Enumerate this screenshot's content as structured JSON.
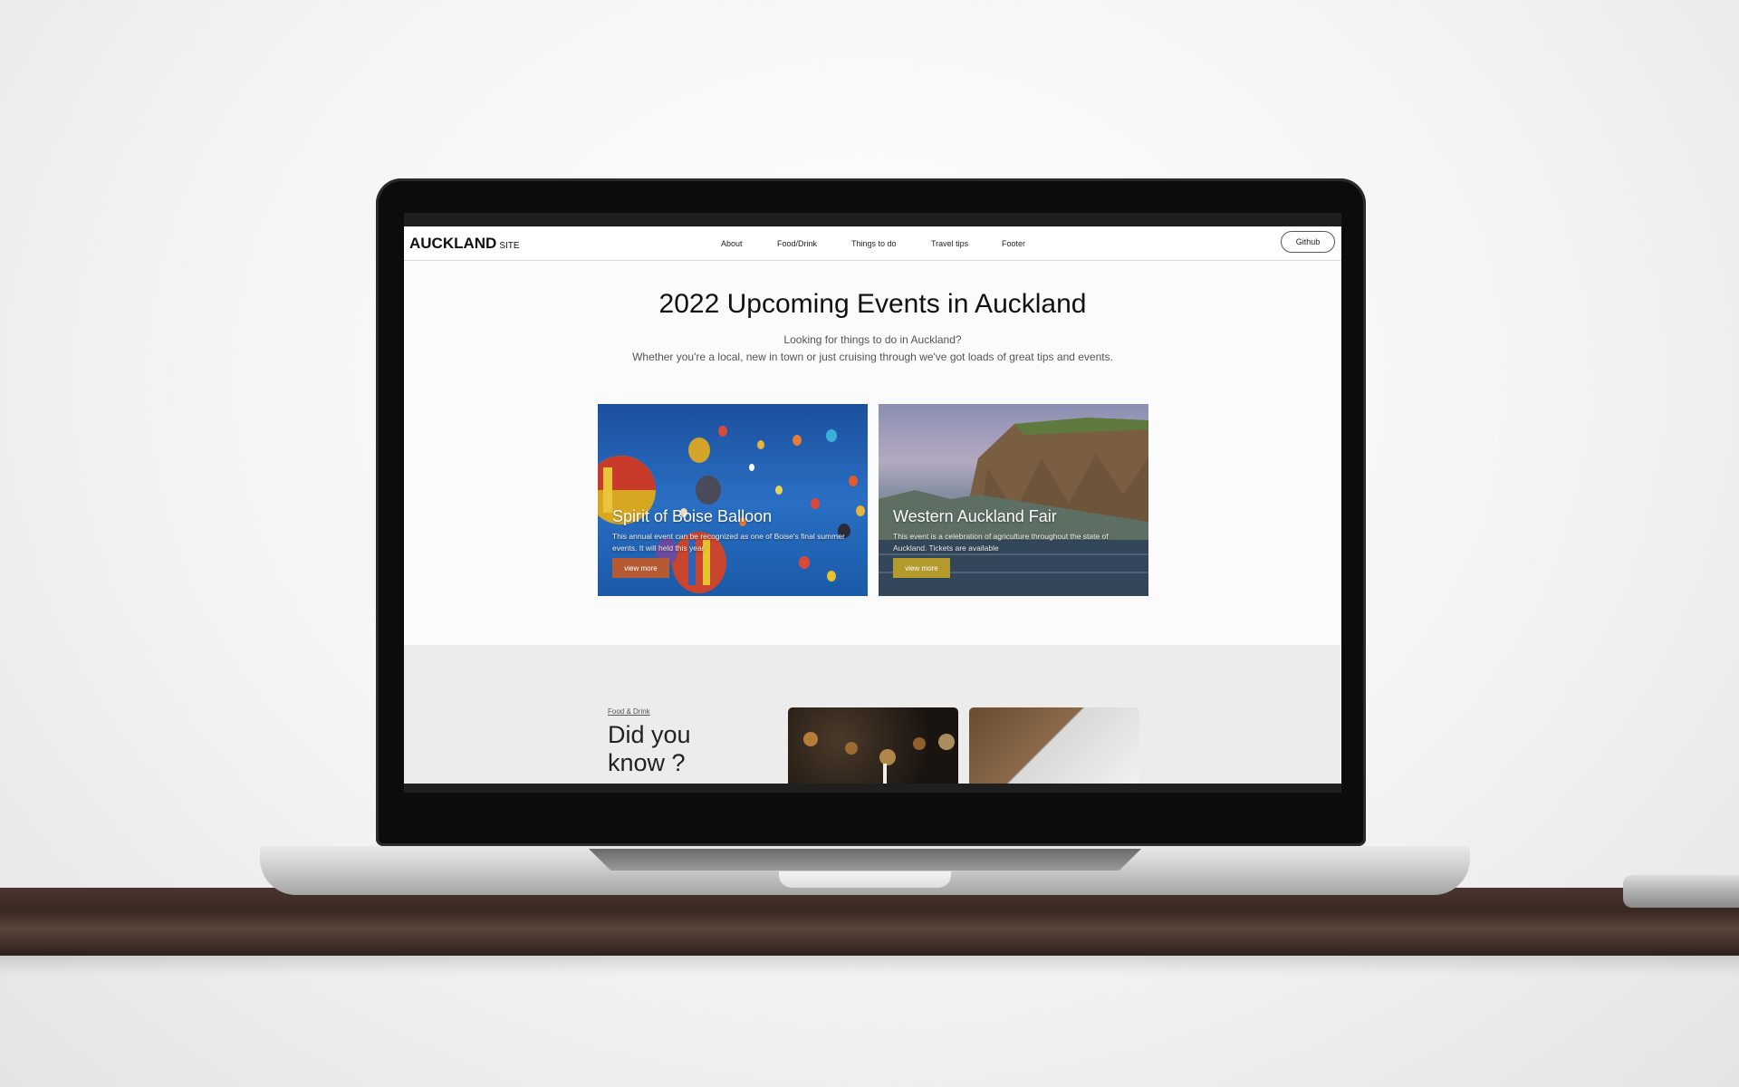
{
  "site": {
    "logo": "AUCKLAND",
    "logo_sub": "SITE",
    "nav": [
      "About",
      "Food/Drink",
      "Things to do",
      "Travel tips",
      "Footer"
    ],
    "github_label": "Github"
  },
  "hero": {
    "title": "2022 Upcoming Events in Auckland",
    "subtitle_line1": "Looking for things to do in Auckland?",
    "subtitle_line2": "Whether you're a local, new in town or just cruising through we've got loads of great tips and events."
  },
  "cards": [
    {
      "title": "Spirit of Boise Balloon",
      "description": "This annual event can be recognized as one of Boise's final summer events. It will held this year",
      "button": "view more",
      "accent": "#b55a32"
    },
    {
      "title": "Western Auckland Fair",
      "description": "This event is a celebration of agriculture throughout the state of Auckland. Tickets are available",
      "button": "view more",
      "accent": "#b49a2c"
    }
  ],
  "section2": {
    "label": "Food & Drink",
    "title": "Did you know ?"
  }
}
